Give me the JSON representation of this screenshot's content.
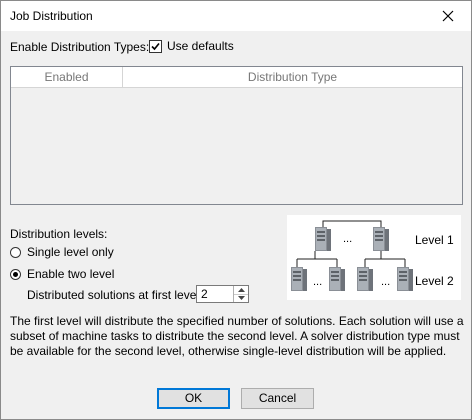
{
  "window": {
    "title": "Job Distribution"
  },
  "enable_types": {
    "label": "Enable Distribution Types:",
    "use_defaults_label": "Use defaults",
    "use_defaults_checked": true
  },
  "table": {
    "columns": [
      "Enabled",
      "Distribution Type"
    ],
    "rows": []
  },
  "levels": {
    "label": "Distribution levels:",
    "options": [
      {
        "label": "Single level only",
        "selected": false
      },
      {
        "label": "Enable two level",
        "selected": true
      }
    ],
    "first_level_label": "Distributed solutions at first level:",
    "first_level_value": "2"
  },
  "diagram": {
    "level1_label": "Level 1",
    "level2_label": "Level 2",
    "ellipsis": "..."
  },
  "description": "The first level will distribute the specified number of solutions. Each solution will use a subset of machine tasks to distribute the second level. A solver distribution type must be available for the second level, otherwise single-level distribution will be applied.",
  "buttons": {
    "ok": "OK",
    "cancel": "Cancel"
  },
  "icons": {
    "close": "close-icon",
    "check": "checkmark-icon",
    "server": "server-icon"
  }
}
